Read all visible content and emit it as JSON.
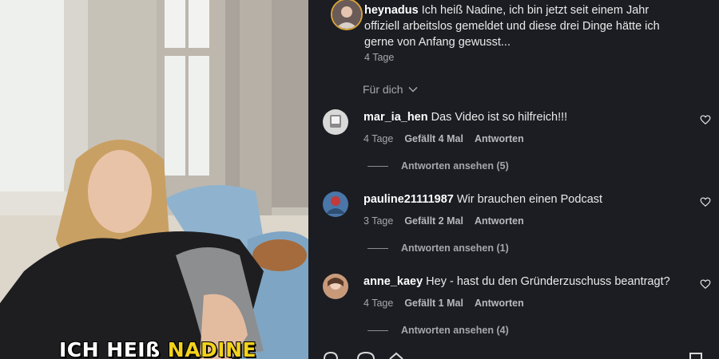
{
  "video": {
    "caption_prefix": "ICH HEIß",
    "caption_highlight": "NADINE",
    "highlight_color": "#f3d21c"
  },
  "post": {
    "username": "heynadus",
    "text": "Ich heiß Nadine, ich bin jetzt seit einem Jahr offiziell arbeitslos gemeldet und diese drei Dinge hätte ich gerne von Anfang gewusst...",
    "time": "4 Tage",
    "avatar_ring_color": "#d8a43a"
  },
  "sort": {
    "label": "Für dich",
    "icon": "chevron-down-icon"
  },
  "comments": [
    {
      "username": "mar_ia_hen",
      "text": "Das Video ist so hilfreich!!!",
      "time": "4 Tage",
      "likes": "Gefällt 4 Mal",
      "reply": "Antworten",
      "replies": "Antworten ansehen (5)",
      "avatar_color": "#d9d9d9"
    },
    {
      "username": "pauline21111987",
      "text": "Wir brauchen einen Podcast",
      "time": "3 Tage",
      "likes": "Gefällt 2 Mal",
      "reply": "Antworten",
      "replies": "Antworten ansehen (1)",
      "avatar_color": "#4a76a8"
    },
    {
      "username": "anne_kaey",
      "text": "Hey - hast du den Gründerzuschuss beantragt?",
      "time": "4 Tage",
      "likes": "Gefällt 1 Mal",
      "reply": "Antworten",
      "replies": "Antworten ansehen (4)",
      "avatar_color": "#c99a7a"
    }
  ]
}
